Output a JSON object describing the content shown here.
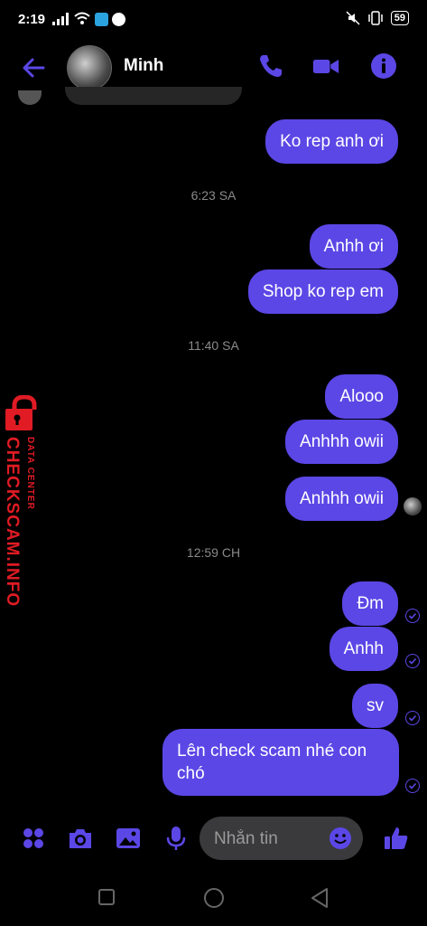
{
  "status_bar": {
    "time": "2:19",
    "battery": "59"
  },
  "header": {
    "contact_name": "Minh"
  },
  "messages": [
    {
      "text": "Ko rep anh ơi"
    },
    {
      "time": "6:23 SA"
    },
    {
      "text": "Anhh ơi"
    },
    {
      "text": "Shop ko rep em"
    },
    {
      "time": "11:40 SA"
    },
    {
      "text": "Alooo"
    },
    {
      "text": "Anhhh owii"
    },
    {
      "text": "Anhhh owii"
    },
    {
      "time": "12:59 CH"
    },
    {
      "text": "Đm"
    },
    {
      "text": "Anhh"
    },
    {
      "text": "sv"
    },
    {
      "text": "Lên check scam nhé con chó"
    }
  ],
  "watermark": {
    "brand": "CHECKSCAM.INFO",
    "subtitle": "DATA CENTER"
  },
  "composer": {
    "placeholder": "Nhắn tin"
  },
  "colors": {
    "accent": "#5b47e6",
    "bubble": "#5b47e6",
    "background": "#000000",
    "watermark": "#e01b24"
  },
  "icons": [
    "back-arrow-icon",
    "phone-icon",
    "video-icon",
    "info-icon",
    "apps-icon",
    "camera-icon",
    "image-icon",
    "mic-icon",
    "emoji-icon",
    "thumbs-up-icon",
    "seen-check-icon"
  ]
}
